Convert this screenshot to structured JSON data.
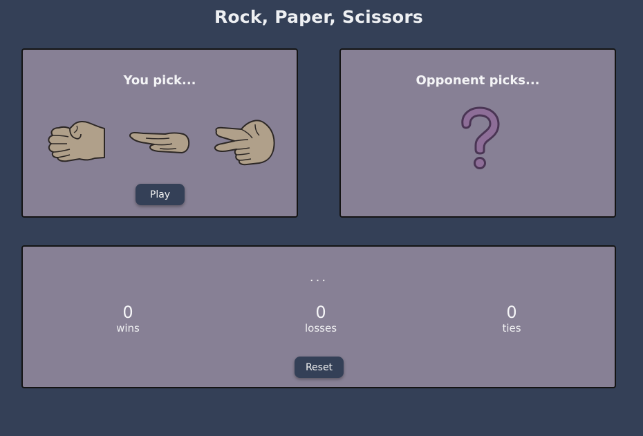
{
  "header": {
    "title": "Rock, Paper, Scissors"
  },
  "player_panel": {
    "heading": "You pick...",
    "choices": [
      {
        "name": "rock",
        "icon": "rock-hand-icon"
      },
      {
        "name": "paper",
        "icon": "paper-hand-icon"
      },
      {
        "name": "scissors",
        "icon": "scissors-hand-icon"
      }
    ],
    "play_label": "Play"
  },
  "opponent_panel": {
    "heading": "Opponent picks...",
    "icon": "question-mark-icon"
  },
  "score_panel": {
    "status": "...",
    "wins": {
      "value": "0",
      "label": "wins"
    },
    "losses": {
      "value": "0",
      "label": "losses"
    },
    "ties": {
      "value": "0",
      "label": "ties"
    },
    "reset_label": "Reset"
  },
  "colors": {
    "background": "#344057",
    "panel": "#878095",
    "button": "#344057",
    "hand_fill": "#b0a08a",
    "question_stroke": "#4a3554",
    "question_fill": "#8e6e98"
  }
}
